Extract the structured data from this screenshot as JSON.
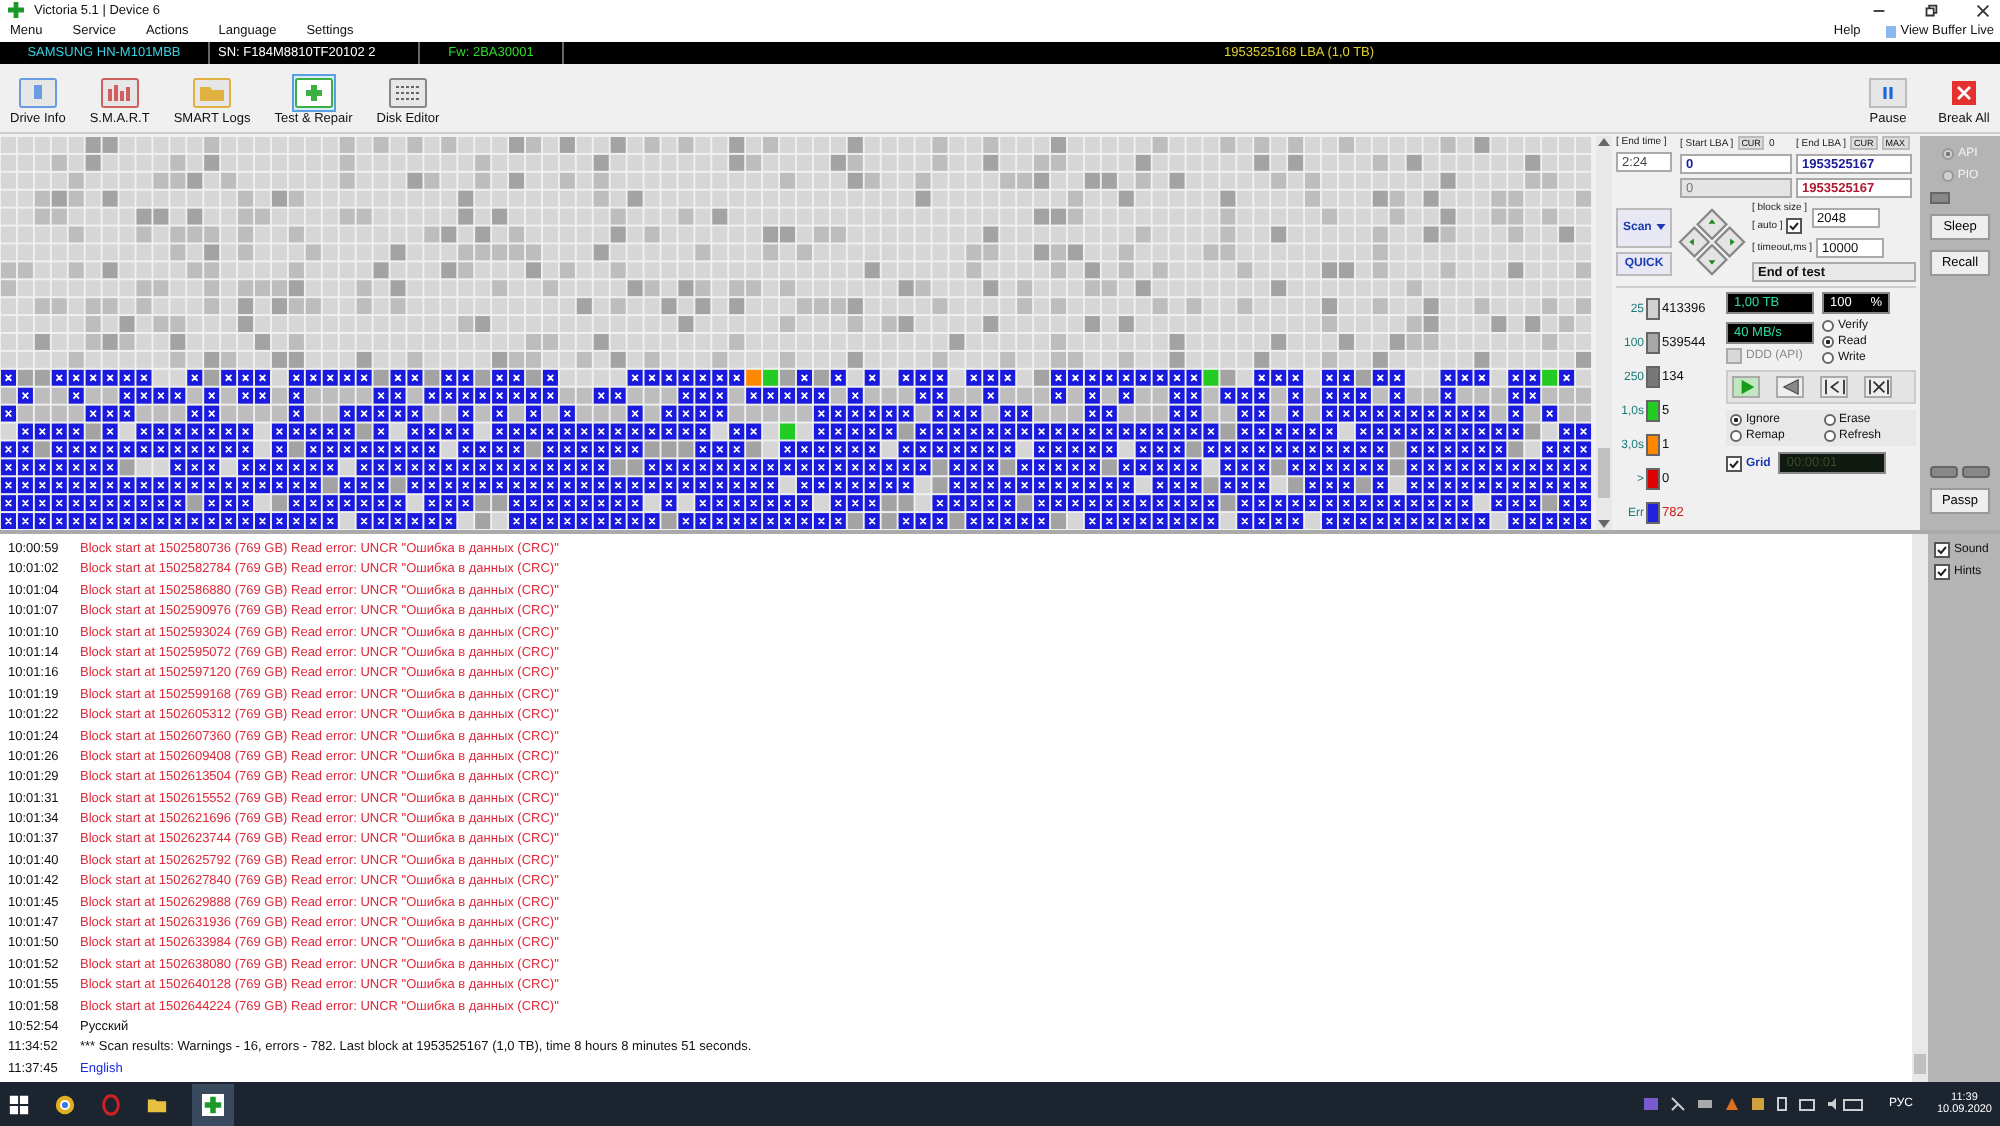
{
  "window": {
    "title": "Victoria 5.1 | Device 6"
  },
  "menu": [
    "Menu",
    "Service",
    "Actions",
    "Language",
    "Settings"
  ],
  "help_menu": "Help",
  "view_buffer_live": "View Buffer Live",
  "drive_info": {
    "model": "SAMSUNG HN-M101MBB",
    "serial": "SN: F184M8810TF20102 2",
    "firmware": "Fw: 2BA30001",
    "capacity": "1953525168 LBA (1,0 TB)"
  },
  "toolbar": [
    {
      "label": "Drive Info",
      "kind": "info",
      "selected": false
    },
    {
      "label": "S.M.A.R.T",
      "kind": "smart",
      "selected": false
    },
    {
      "label": "SMART Logs",
      "kind": "logs",
      "selected": false
    },
    {
      "label": "Test & Repair",
      "kind": "test",
      "selected": true
    },
    {
      "label": "Disk Editor",
      "kind": "editor",
      "selected": false
    }
  ],
  "actions": [
    {
      "label": "Pause",
      "kind": "pause"
    },
    {
      "label": "Break All",
      "kind": "break"
    }
  ],
  "scan_panel": {
    "end_time_label": "[ End time ]",
    "end_time": "2:24",
    "start_lba_label": "[ Start LBA ]",
    "start_cur": "CUR",
    "start_cur_value": "0",
    "end_lba_label": "[ End LBA ]",
    "end_cur": "CUR",
    "end_max": "MAX",
    "start_lba": "0",
    "end_lba": "1953525167",
    "current_lba": "0",
    "current_end_lba": "1953525167",
    "scan_button": "Scan",
    "quick_button": "QUICK",
    "block_size_label": "[ block size ]",
    "auto_label": "[ auto ]",
    "auto_checked": true,
    "block_size": "2048",
    "timeout_label": "[ timeout,ms ]",
    "timeout": "10000",
    "end_action": "End of test"
  },
  "counters": [
    {
      "label": "25",
      "value": "413396",
      "color": "#d0d0d0"
    },
    {
      "label": "100",
      "value": "539544",
      "color": "#a8a8a8"
    },
    {
      "label": "250",
      "value": "134",
      "color": "#787878"
    },
    {
      "label": "1,0s",
      "value": "5",
      "color": "#22cc22"
    },
    {
      "label": "3,0s",
      "value": "1",
      "color": "#ff8800"
    },
    {
      "label": ">",
      "value": "0",
      "color": "#dd0000"
    },
    {
      "label": "Err",
      "value": "782",
      "color": "#2020dd"
    }
  ],
  "progress": {
    "size": "1,00 TB",
    "percent": "100",
    "percent_sign": "%",
    "speed": "40 MB/s"
  },
  "ddd_api": {
    "label": "DDD (API)",
    "checked": false,
    "disabled": true
  },
  "modes": [
    {
      "label": "Verify",
      "selected": false
    },
    {
      "label": "Read",
      "selected": true
    },
    {
      "label": "Write",
      "selected": false
    }
  ],
  "transport": [
    {
      "kind": "play",
      "selected": true
    },
    {
      "kind": "back",
      "selected": false
    },
    {
      "kind": "skip-back",
      "selected": false
    },
    {
      "kind": "skip-end",
      "selected": false
    }
  ],
  "repair_modes": [
    {
      "label": "Ignore",
      "selected": true
    },
    {
      "label": "Erase",
      "selected": false
    },
    {
      "label": "Remap",
      "selected": false
    },
    {
      "label": "Refresh",
      "selected": false
    }
  ],
  "grid_toggle": {
    "label": "Grid",
    "checked": true
  },
  "timer": "00:00:01",
  "interface": [
    {
      "label": "API",
      "selected": true,
      "disabled": true
    },
    {
      "label": "PIO",
      "selected": false,
      "disabled": true
    }
  ],
  "side_buttons": [
    "Sleep",
    "Recall",
    "Passp"
  ],
  "log": [
    {
      "time": "10:00:59",
      "text": "Block start at 1502580736 (769 GB) Read error: UNCR \"Ошибка в данных (CRC)\"",
      "kind": "error"
    },
    {
      "time": "10:01:02",
      "text": "Block start at 1502582784 (769 GB) Read error: UNCR \"Ошибка в данных (CRC)\"",
      "kind": "error"
    },
    {
      "time": "10:01:04",
      "text": "Block start at 1502586880 (769 GB) Read error: UNCR \"Ошибка в данных (CRC)\"",
      "kind": "error"
    },
    {
      "time": "10:01:07",
      "text": "Block start at 1502590976 (769 GB) Read error: UNCR \"Ошибка в данных (CRC)\"",
      "kind": "error"
    },
    {
      "time": "10:01:10",
      "text": "Block start at 1502593024 (769 GB) Read error: UNCR \"Ошибка в данных (CRC)\"",
      "kind": "error"
    },
    {
      "time": "10:01:14",
      "text": "Block start at 1502595072 (769 GB) Read error: UNCR \"Ошибка в данных (CRC)\"",
      "kind": "error"
    },
    {
      "time": "10:01:16",
      "text": "Block start at 1502597120 (769 GB) Read error: UNCR \"Ошибка в данных (CRC)\"",
      "kind": "error"
    },
    {
      "time": "10:01:19",
      "text": "Block start at 1502599168 (769 GB) Read error: UNCR \"Ошибка в данных (CRC)\"",
      "kind": "error"
    },
    {
      "time": "10:01:22",
      "text": "Block start at 1502605312 (769 GB) Read error: UNCR \"Ошибка в данных (CRC)\"",
      "kind": "error"
    },
    {
      "time": "10:01:24",
      "text": "Block start at 1502607360 (769 GB) Read error: UNCR \"Ошибка в данных (CRC)\"",
      "kind": "error"
    },
    {
      "time": "10:01:26",
      "text": "Block start at 1502609408 (769 GB) Read error: UNCR \"Ошибка в данных (CRC)\"",
      "kind": "error"
    },
    {
      "time": "10:01:29",
      "text": "Block start at 1502613504 (769 GB) Read error: UNCR \"Ошибка в данных (CRC)\"",
      "kind": "error"
    },
    {
      "time": "10:01:31",
      "text": "Block start at 1502615552 (769 GB) Read error: UNCR \"Ошибка в данных (CRC)\"",
      "kind": "error"
    },
    {
      "time": "10:01:34",
      "text": "Block start at 1502621696 (769 GB) Read error: UNCR \"Ошибка в данных (CRC)\"",
      "kind": "error"
    },
    {
      "time": "10:01:37",
      "text": "Block start at 1502623744 (769 GB) Read error: UNCR \"Ошибка в данных (CRC)\"",
      "kind": "error"
    },
    {
      "time": "10:01:40",
      "text": "Block start at 1502625792 (769 GB) Read error: UNCR \"Ошибка в данных (CRC)\"",
      "kind": "error"
    },
    {
      "time": "10:01:42",
      "text": "Block start at 1502627840 (769 GB) Read error: UNCR \"Ошибка в данных (CRC)\"",
      "kind": "error"
    },
    {
      "time": "10:01:45",
      "text": "Block start at 1502629888 (769 GB) Read error: UNCR \"Ошибка в данных (CRC)\"",
      "kind": "error"
    },
    {
      "time": "10:01:47",
      "text": "Block start at 1502631936 (769 GB) Read error: UNCR \"Ошибка в данных (CRC)\"",
      "kind": "error"
    },
    {
      "time": "10:01:50",
      "text": "Block start at 1502633984 (769 GB) Read error: UNCR \"Ошибка в данных (CRC)\"",
      "kind": "error"
    },
    {
      "time": "10:01:52",
      "text": "Block start at 1502638080 (769 GB) Read error: UNCR \"Ошибка в данных (CRC)\"",
      "kind": "error"
    },
    {
      "time": "10:01:55",
      "text": "Block start at 1502640128 (769 GB) Read error: UNCR \"Ошибка в данных (CRC)\"",
      "kind": "error"
    },
    {
      "time": "10:01:58",
      "text": "Block start at 1502644224 (769 GB) Read error: UNCR \"Ошибка в данных (CRC)\"",
      "kind": "error"
    },
    {
      "time": "10:52:54",
      "text": "Русский",
      "kind": "info"
    },
    {
      "time": "11:34:52",
      "text": "*** Scan results: Warnings - 16, errors - 782. Last block at 1953525167 (1,0 TB), time 8 hours 8 minutes 51 seconds.",
      "kind": "info"
    },
    {
      "time": "11:37:45",
      "text": "English",
      "kind": "language"
    }
  ],
  "log_options": [
    {
      "label": "Sound",
      "checked": true
    },
    {
      "label": "Hints",
      "checked": true
    }
  ],
  "taskbar": {
    "language": "РУС",
    "time": "11:39",
    "date": "10.09.2020"
  }
}
